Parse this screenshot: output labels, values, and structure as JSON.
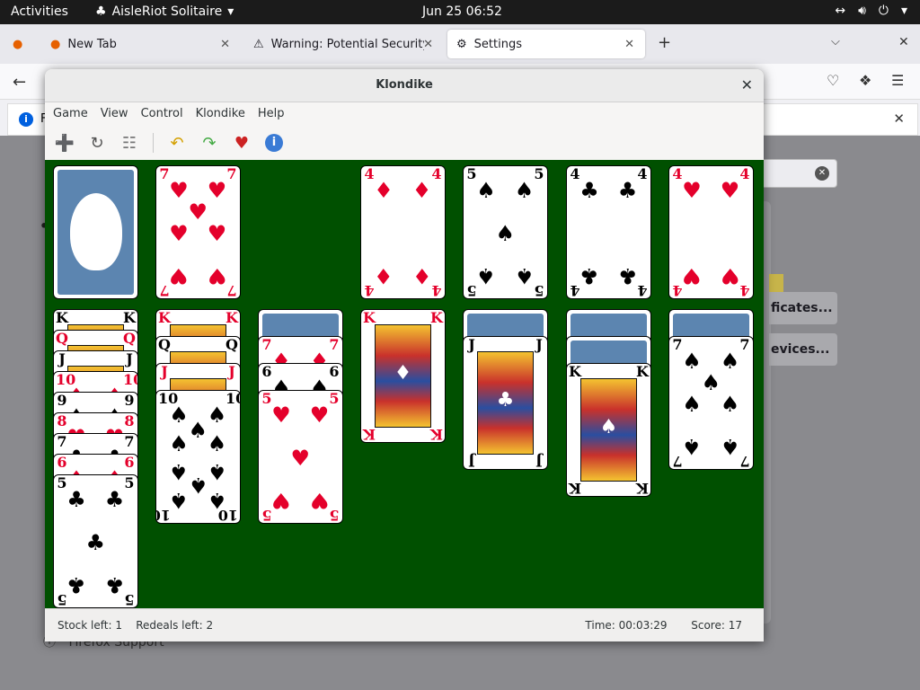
{
  "topbar": {
    "activities": "Activities",
    "app_name": "AisleRiot Solitaire",
    "clock": "Jun 25  06:52"
  },
  "firefox": {
    "tabs": [
      {
        "label": "",
        "icon": "firefox-icon"
      },
      {
        "label": "New Tab",
        "icon": "firefox-icon"
      },
      {
        "label": "Warning: Potential Security R",
        "icon": "warning-icon"
      },
      {
        "label": "Settings",
        "icon": "gear-icon"
      }
    ],
    "notice_text": "F",
    "buttons": [
      "ficates...",
      "evices..."
    ],
    "support_link": "Firefox Support"
  },
  "window": {
    "title": "Klondike",
    "menu": [
      "Game",
      "View",
      "Control",
      "Klondike",
      "Help"
    ],
    "toolbar": [
      {
        "name": "new-game-button",
        "icon": "new-game-icon"
      },
      {
        "name": "restart-button",
        "icon": "restart-icon"
      },
      {
        "name": "select-game-button",
        "icon": "select-game-icon"
      },
      {
        "name": "undo-button",
        "icon": "undo-icon"
      },
      {
        "name": "redo-button",
        "icon": "redo-icon"
      },
      {
        "name": "hint-button",
        "icon": "hint-icon"
      },
      {
        "name": "help-button",
        "icon": "info-icon"
      }
    ],
    "status": {
      "stock": "Stock left: 1",
      "redeals": "Redeals left: 2",
      "time": "Time:   00:03:29",
      "score": "Score:   17"
    }
  },
  "board": {
    "stock": {
      "cards_left": 1,
      "back": "gnome-foot-icon"
    },
    "waste": {
      "rank": "7",
      "suit": "hearts"
    },
    "foundations": [
      {
        "rank": "4",
        "suit": "diamonds"
      },
      {
        "rank": "5",
        "suit": "spades"
      },
      {
        "rank": "4",
        "suit": "clubs"
      },
      {
        "rank": "4",
        "suit": "hearts"
      }
    ],
    "tableau": [
      {
        "hidden": 0,
        "visible": [
          "K",
          "Q",
          "J",
          "10",
          "9",
          "8",
          "7",
          "6",
          "5"
        ],
        "suits": [
          "spades",
          "hearts",
          "clubs",
          "diamonds",
          "spades",
          "hearts",
          "clubs",
          "diamonds",
          "clubs"
        ]
      },
      {
        "hidden": 0,
        "visible": [
          "K",
          "Q",
          "J",
          "10"
        ],
        "suits": [
          "hearts",
          "spades",
          "diamonds",
          "spades"
        ]
      },
      {
        "hidden": 1,
        "visible": [
          "7",
          "6",
          "5"
        ],
        "suits": [
          "diamonds",
          "spades",
          "hearts"
        ]
      },
      {
        "hidden": 0,
        "visible": [
          "K"
        ],
        "suits": [
          "diamonds"
        ]
      },
      {
        "hidden": 1,
        "visible": [
          "J"
        ],
        "suits": [
          "clubs"
        ]
      },
      {
        "hidden": 2,
        "visible": [
          "K"
        ],
        "suits": [
          "spades"
        ]
      },
      {
        "hidden": 1,
        "visible": [
          "7"
        ],
        "suits": [
          "spades"
        ]
      }
    ]
  }
}
